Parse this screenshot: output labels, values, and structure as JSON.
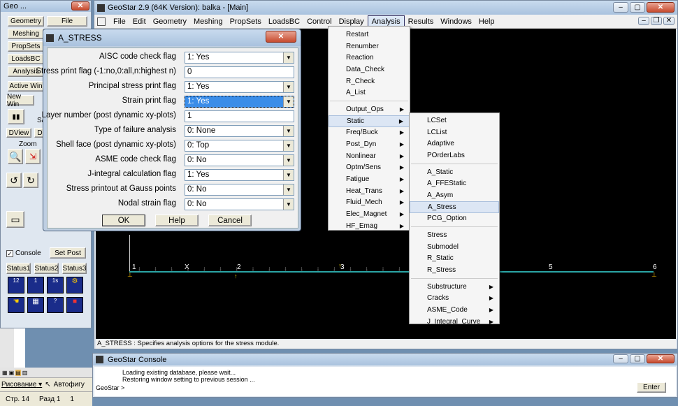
{
  "left_panel": {
    "title": "Geo ...",
    "buttons": [
      {
        "label": "Geometry"
      },
      {
        "label": "File"
      },
      {
        "label": "Meshing"
      },
      {
        "label": "PropSets"
      },
      {
        "label": "LoadsBC"
      },
      {
        "label": "Analysis"
      },
      {
        "label": "Active Win"
      },
      {
        "label": "New Win"
      }
    ],
    "dview": "DView",
    "d2": "D",
    "zoom": "Zoom",
    "sa": "Sa",
    "console_label": "Console",
    "set_post": "Set Post",
    "status_tabs": [
      "Status1",
      "Status2",
      "Status3"
    ]
  },
  "main_window": {
    "title": "GeoStar 2.9 (64K Version): balka - [Main]",
    "menu": [
      "File",
      "Edit",
      "Geometry",
      "Meshing",
      "PropSets",
      "LoadsBC",
      "Control",
      "Display",
      "Analysis",
      "Results",
      "Windows",
      "Help"
    ],
    "status_text": "A_STRESS : Specifies analysis options for the stress module."
  },
  "analysis_menu": {
    "group1": [
      "Restart",
      "Renumber",
      "Reaction",
      "Data_Check",
      "R_Check",
      "A_List"
    ],
    "group2": [
      {
        "label": "Output_Ops",
        "sub": true
      },
      {
        "label": "Static",
        "sub": true
      },
      {
        "label": "Freq/Buck",
        "sub": true
      },
      {
        "label": "Post_Dyn",
        "sub": true
      },
      {
        "label": "Nonlinear",
        "sub": true
      },
      {
        "label": "Optm/Sens",
        "sub": true
      },
      {
        "label": "Fatigue",
        "sub": true
      },
      {
        "label": "Heat_Trans",
        "sub": true
      },
      {
        "label": "Fluid_Mech",
        "sub": true
      },
      {
        "label": "Elec_Magnet",
        "sub": true
      },
      {
        "label": "HF_Emag",
        "sub": true
      }
    ]
  },
  "static_menu": {
    "group1": [
      "LCSet",
      "LCList",
      "Adaptive",
      "POrderLabs"
    ],
    "group2": [
      "A_Static",
      "A_FFEStatic",
      "A_Asym",
      "A_Stress",
      "PCG_Option"
    ],
    "group3": [
      "Stress",
      "Submodel",
      "R_Static",
      "R_Stress"
    ],
    "group4": [
      {
        "label": "Substructure",
        "sub": true
      },
      {
        "label": "Cracks",
        "sub": true
      },
      {
        "label": "ASME_Code",
        "sub": true
      },
      {
        "label": "J_Integral_Curve",
        "sub": true
      }
    ]
  },
  "dialog": {
    "title": "A_STRESS",
    "fields": [
      {
        "label": "AISC code check flag",
        "value": "1: Yes",
        "type": "combo"
      },
      {
        "label": "Stress print flag (-1:no,0:all,n:highest n)",
        "value": "0",
        "type": "text"
      },
      {
        "label": "Principal stress print flag",
        "value": "1: Yes",
        "type": "combo"
      },
      {
        "label": "Strain print flag",
        "value": "1: Yes",
        "type": "combo-focus"
      },
      {
        "label": "Layer number (post dynamic xy-plots)",
        "value": "1",
        "type": "text"
      },
      {
        "label": "Type of failure analysis",
        "value": "0: None",
        "type": "combo"
      },
      {
        "label": "Shell face (post dynamic xy-plots)",
        "value": "0: Top",
        "type": "combo"
      },
      {
        "label": "ASME code check flag",
        "value": "0: No",
        "type": "combo"
      },
      {
        "label": "J-integral calculation flag",
        "value": "1: Yes",
        "type": "combo"
      },
      {
        "label": "Stress printout at Gauss points",
        "value": "0: No",
        "type": "combo"
      },
      {
        "label": "Nodal strain flag",
        "value": "0: No",
        "type": "combo"
      }
    ],
    "ok": "OK",
    "help": "Help",
    "cancel": "Cancel"
  },
  "canvas": {
    "nodes": [
      "1",
      "2",
      "3",
      "5",
      "6"
    ],
    "origin_label": "X"
  },
  "console": {
    "title": "GeoStar Console",
    "lines": [
      "Loading existing database, please wait...",
      "Restoring window setting to previous session ..."
    ],
    "prompt": "GeoStar >",
    "enter": "Enter"
  },
  "word_bar": {
    "drawing": "Рисование",
    "autoshapes": "Автофигу",
    "page": "Стр. 14",
    "section": "Разд 1",
    "fraction": "1"
  },
  "colors": {
    "canvas_bg": "#000000",
    "beam": "#2aa5a5",
    "selection": "#3399ff"
  }
}
